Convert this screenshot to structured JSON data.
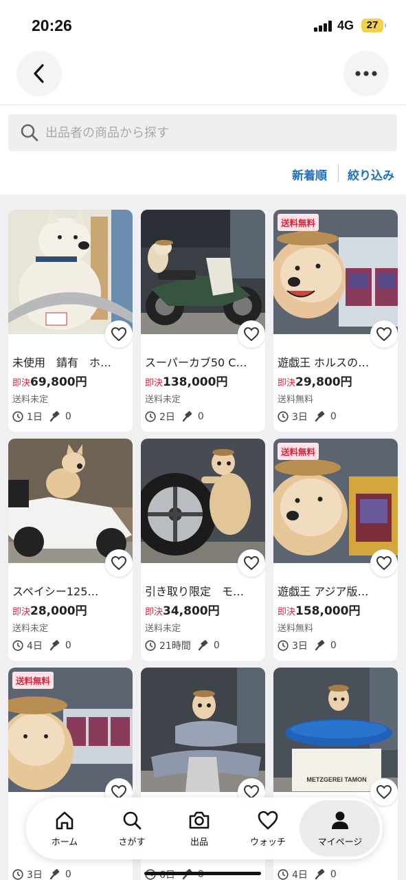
{
  "status_bar": {
    "time": "20:26",
    "network": "4G",
    "battery": "27"
  },
  "search": {
    "placeholder": "出品者の商品から探す"
  },
  "sort": {
    "newest": "新着順",
    "filter": "絞り込み"
  },
  "labels": {
    "price_prefix": "即決"
  },
  "items": [
    {
      "title": "未使用　錆有　ホ…",
      "price": "69,800円",
      "shipping": "送料未定",
      "time_left": "1日",
      "bids": "0",
      "free_shipping_badge": ""
    },
    {
      "title": "スーパーカブ50 C…",
      "price": "138,000円",
      "shipping": "送料未定",
      "time_left": "2日",
      "bids": "0",
      "free_shipping_badge": ""
    },
    {
      "title": "遊戯王 ホルスの…",
      "price": "29,800円",
      "shipping": "送料無料",
      "time_left": "3日",
      "bids": "0",
      "free_shipping_badge": "送料無料"
    },
    {
      "title": "スペイシー125…",
      "price": "28,000円",
      "shipping": "送料未定",
      "time_left": "4日",
      "bids": "0",
      "free_shipping_badge": ""
    },
    {
      "title": "引き取り限定　モ…",
      "price": "34,800円",
      "shipping": "送料未定",
      "time_left": "21時間",
      "bids": "0",
      "free_shipping_badge": ""
    },
    {
      "title": "遊戯王 アジア版…",
      "price": "158,000円",
      "shipping": "送料無料",
      "time_left": "3日",
      "bids": "0",
      "free_shipping_badge": "送料無料"
    },
    {
      "title": "",
      "price": "",
      "shipping": "",
      "time_left": "3日",
      "bids": "0",
      "free_shipping_badge": "送料無料"
    },
    {
      "title": "",
      "price": "",
      "shipping": "",
      "time_left": "6日",
      "bids": "0",
      "free_shipping_badge": ""
    },
    {
      "title": "",
      "price": "",
      "shipping": "",
      "time_left": "4日",
      "bids": "0",
      "free_shipping_badge": ""
    }
  ],
  "product_image_text": {
    "crate_label": "METZGEREI TAMON"
  },
  "tabs": [
    {
      "label": "ホーム",
      "icon": "home-icon"
    },
    {
      "label": "さがす",
      "icon": "search-icon"
    },
    {
      "label": "出品",
      "icon": "camera-icon"
    },
    {
      "label": "ウォッチ",
      "icon": "heart-icon"
    },
    {
      "label": "マイページ",
      "icon": "person-icon",
      "active": true
    }
  ],
  "colors": {
    "accent_link": "#1d6fc8",
    "price_prefix": "#e0203a",
    "badge_bg": "#ffe3e7"
  }
}
